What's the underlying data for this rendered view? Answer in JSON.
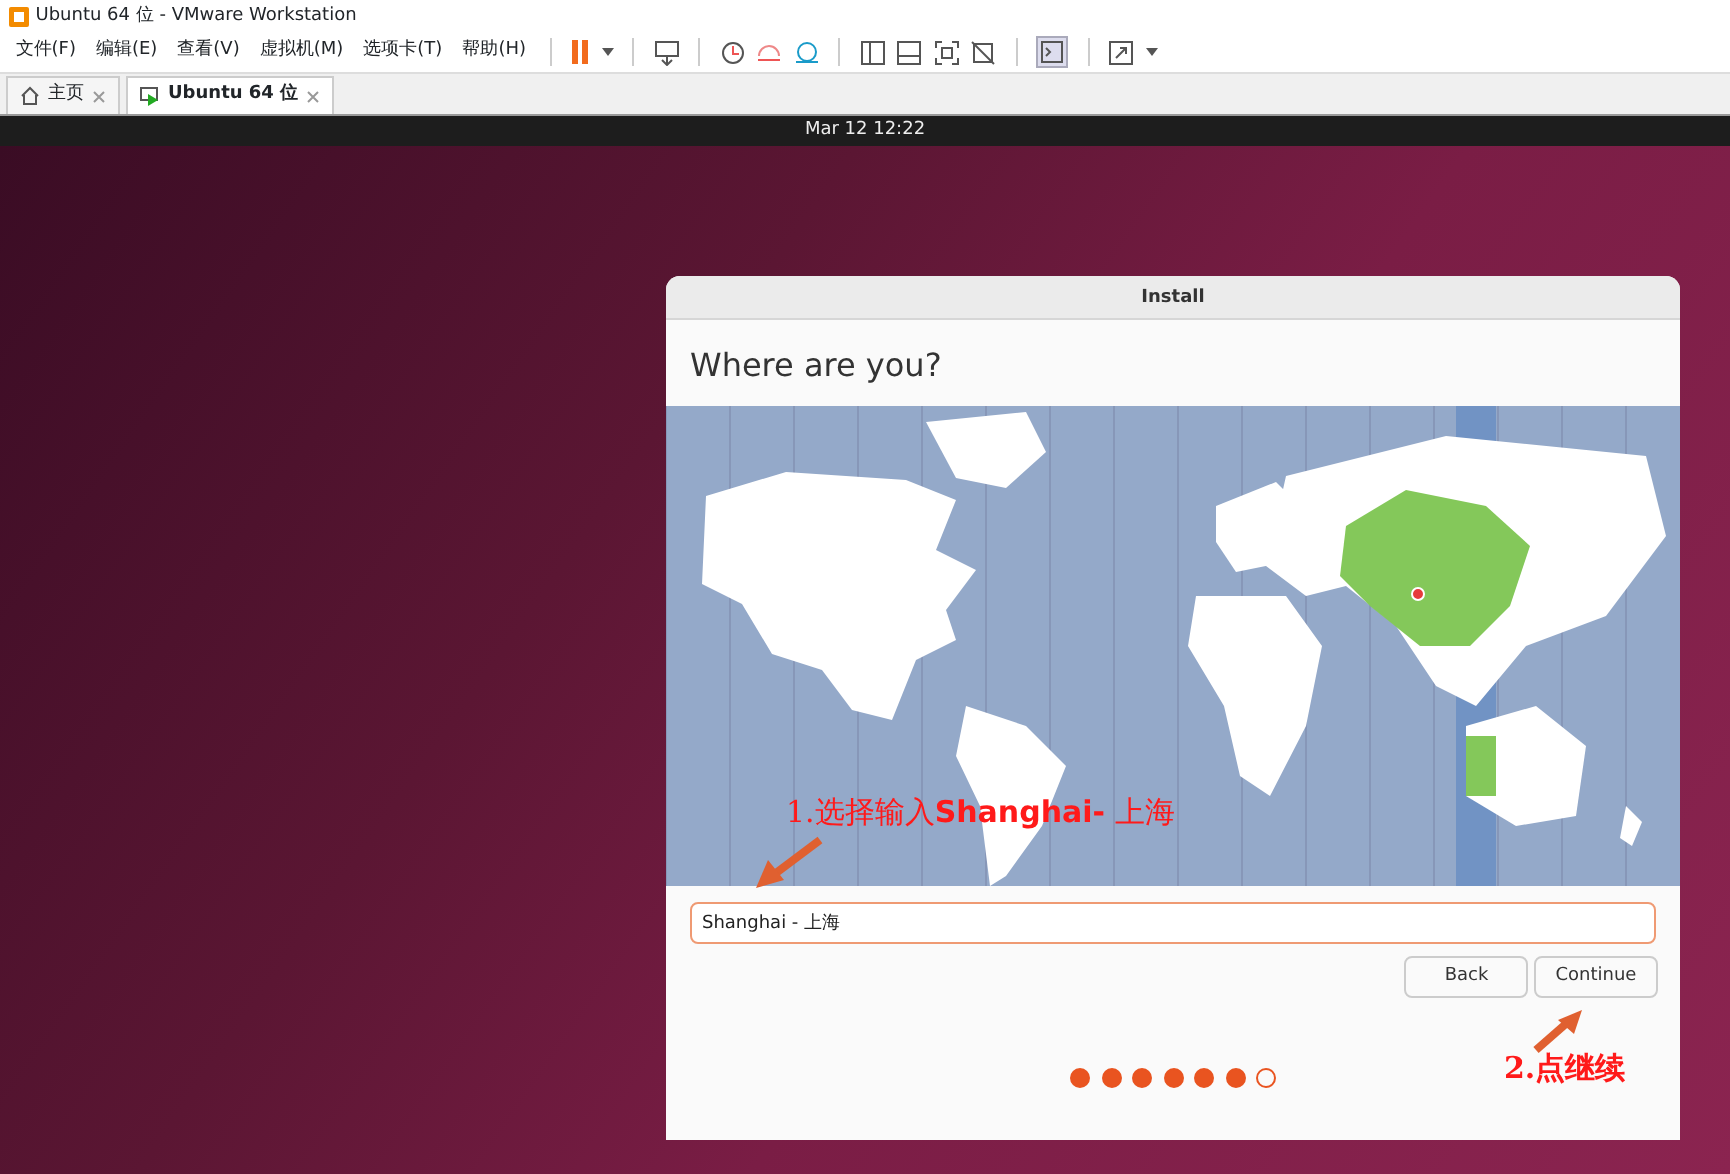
{
  "window": {
    "title": "Ubuntu 64 位 - VMware Workstation"
  },
  "menu": [
    "文件(F)",
    "编辑(E)",
    "查看(V)",
    "虚拟机(M)",
    "选项卡(T)",
    "帮助(H)"
  ],
  "tabs": [
    {
      "label": "主页",
      "selected": false
    },
    {
      "label": "Ubuntu 64 位",
      "selected": true
    }
  ],
  "guest_top_bar": {
    "clock": "Mar 12  12:22"
  },
  "dialog": {
    "title": "Install",
    "heading": "Where are you?",
    "location_field": {
      "value": "Shanghai - 上海"
    },
    "buttons": [
      "Back",
      "Continue"
    ],
    "steps": [
      {
        "done": true
      },
      {
        "done": true
      },
      {
        "done": true
      },
      {
        "done": true
      },
      {
        "done": true
      },
      {
        "done": true
      },
      {
        "done": false
      }
    ]
  },
  "annotations": [
    "1.选择输入**Shanghai-** 上海",
    "2.点继续"
  ]
}
